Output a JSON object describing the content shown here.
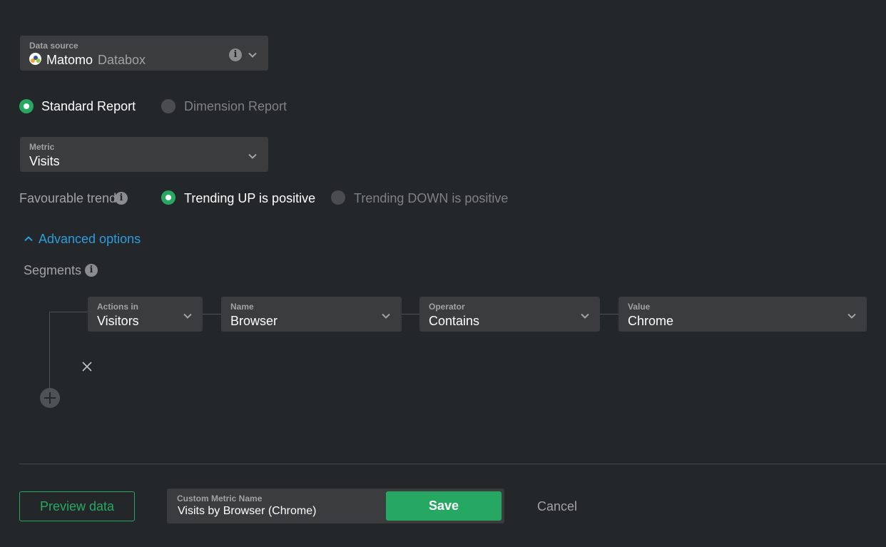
{
  "data_source": {
    "label": "Data source",
    "value": "Matomo",
    "suffix": "Databox",
    "icon": "matomo-logo-icon"
  },
  "report_type": {
    "options": [
      "Standard Report",
      "Dimension Report"
    ],
    "selected": "Standard Report"
  },
  "metric": {
    "label": "Metric",
    "value": "Visits"
  },
  "trend": {
    "label": "Favourable trend",
    "options": [
      "Trending UP is positive",
      "Trending DOWN is positive"
    ],
    "selected": "Trending UP is positive"
  },
  "advanced": {
    "label": "Advanced options"
  },
  "segments": {
    "label": "Segments",
    "fields": [
      {
        "label": "Actions in",
        "value": "Visitors"
      },
      {
        "label": "Name",
        "value": "Browser"
      },
      {
        "label": "Operator",
        "value": "Contains"
      },
      {
        "label": "Value",
        "value": "Chrome"
      }
    ]
  },
  "footer": {
    "preview_label": "Preview data",
    "custom_name_label": "Custom Metric Name",
    "custom_name_value": "Visits by Browser (Chrome)",
    "save_label": "Save",
    "cancel_label": "Cancel"
  },
  "colors": {
    "background": "#24272a",
    "field": "#3a3c3e",
    "accent_green": "#27a862",
    "link_blue": "#2d9cdb"
  }
}
